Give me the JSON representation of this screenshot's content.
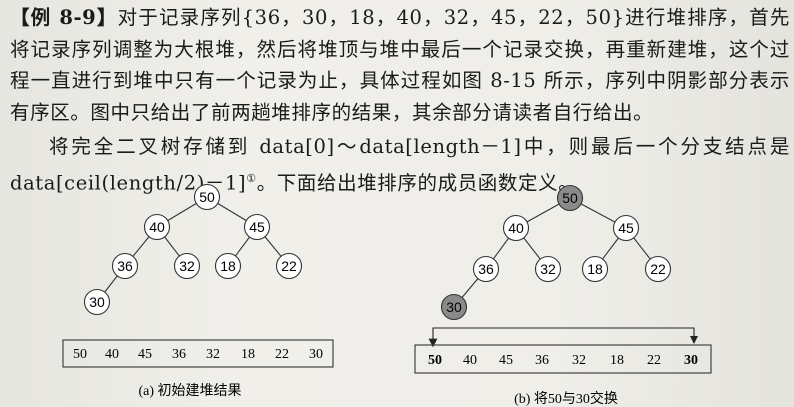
{
  "paragraph1": {
    "label": "【例 8-9】",
    "body": "对于记录序列{36，30，18，40，32，45，22，50}进行堆排序，首先将记录序列调整为大根堆，然后将堆顶与堆中最后一个记录交换，再重新建堆，这个过程一直进行到堆中只有一个记录为止，具体过程如图 8-15 所示，序列中阴影部分表示有序区。图中只给出了前两趟堆排序的结果，其余部分请读者自行给出。"
  },
  "paragraph2": {
    "text": "将完全二叉树存储到 data[0]～data[length－1]中，则最后一个分支结点是 data[ceil(length/2)－1]",
    "footnote_mark": "①",
    "tail": "。下面给出堆排序的成员函数定义。"
  },
  "figure_a": {
    "nodes": [
      "50",
      "40",
      "45",
      "36",
      "32",
      "18",
      "22",
      "30"
    ],
    "array": [
      "50",
      "40",
      "45",
      "36",
      "32",
      "18",
      "22",
      "30"
    ],
    "caption": "(a) 初始建堆结果"
  },
  "figure_b": {
    "nodes": [
      "50",
      "40",
      "45",
      "36",
      "32",
      "18",
      "22",
      "30"
    ],
    "array": [
      "50",
      "40",
      "45",
      "36",
      "32",
      "18",
      "22",
      "30"
    ],
    "caption": "(b) 将50与30交换"
  }
}
